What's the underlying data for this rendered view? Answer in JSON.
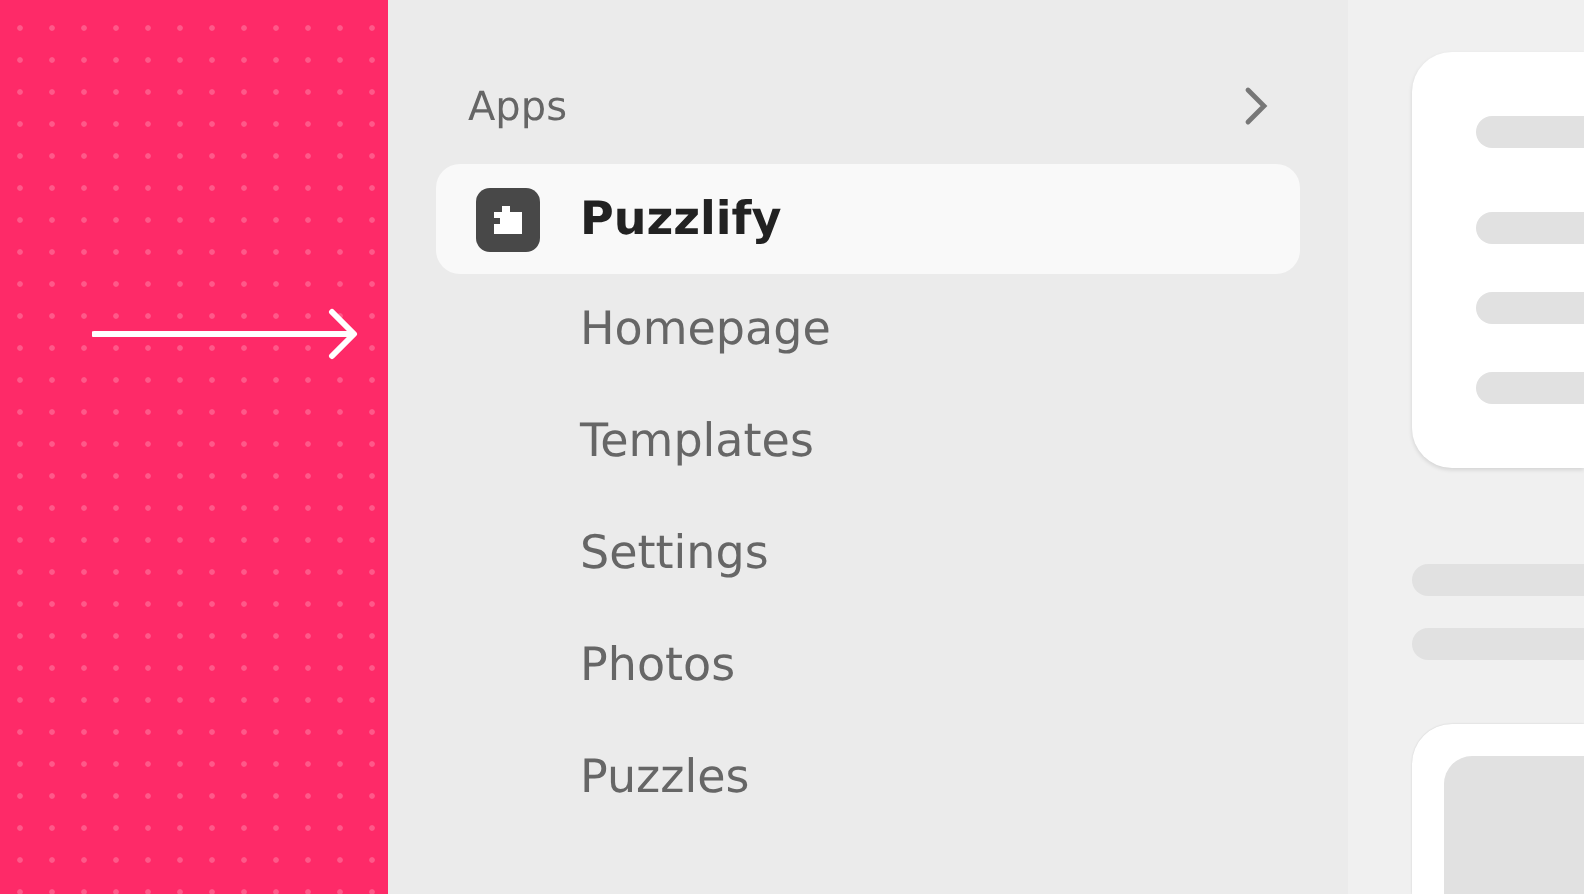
{
  "sidebar": {
    "section_title": "Apps",
    "app": {
      "name": "Puzzlify",
      "selected": true
    },
    "items": [
      {
        "label": "Homepage",
        "selected": false
      },
      {
        "label": "Templates",
        "selected": false
      },
      {
        "label": "Settings",
        "selected": false
      },
      {
        "label": "Photos",
        "selected": false
      },
      {
        "label": "Puzzles",
        "selected": false
      }
    ]
  }
}
